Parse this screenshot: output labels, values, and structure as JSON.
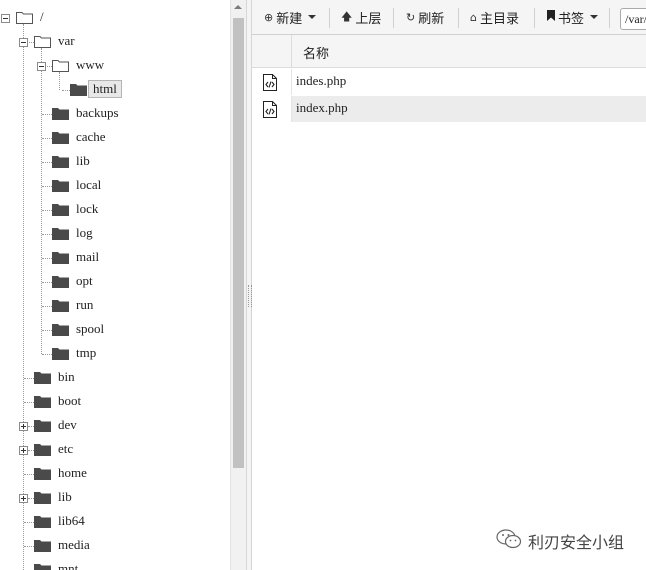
{
  "tree": {
    "root": {
      "label": "/"
    },
    "var": {
      "label": "var"
    },
    "www": {
      "label": "www"
    },
    "html": {
      "label": "html"
    },
    "var_children": [
      "backups",
      "cache",
      "lib",
      "local",
      "lock",
      "log",
      "mail",
      "opt",
      "run",
      "spool",
      "tmp"
    ],
    "root_children": [
      {
        "label": "bin",
        "expandable": false
      },
      {
        "label": "boot",
        "expandable": false
      },
      {
        "label": "dev",
        "expandable": true
      },
      {
        "label": "etc",
        "expandable": true
      },
      {
        "label": "home",
        "expandable": false
      },
      {
        "label": "lib",
        "expandable": true
      },
      {
        "label": "lib64",
        "expandable": false
      },
      {
        "label": "media",
        "expandable": false
      },
      {
        "label": "mnt",
        "expandable": false
      }
    ]
  },
  "toolbar": {
    "new_label": "新建",
    "up_label": "上层",
    "refresh_label": "刷新",
    "home_label": "主目录",
    "bookmark_label": "书签",
    "path_value": "/var/www/html"
  },
  "file_list": {
    "column_name": "名称",
    "files": [
      {
        "name": "indes.php",
        "icon": "code-file-icon"
      },
      {
        "name": "index.php",
        "icon": "code-file-icon"
      }
    ]
  },
  "watermark": {
    "text": "利刃安全小组",
    "icon": "wechat-icon"
  },
  "colors": {
    "folder": "#4a4a4a",
    "toolbar_bg": "#f5f5f5",
    "row_highlight": "#ececec"
  }
}
